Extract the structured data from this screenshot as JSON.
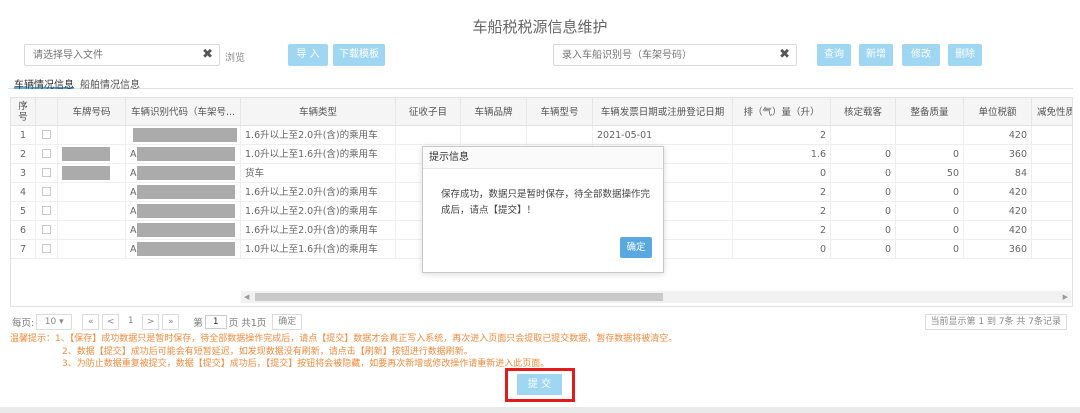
{
  "page": {
    "title": "车船税税源信息维护"
  },
  "toolbar": {
    "file_placeholder": "请选择导入文件",
    "browse_label": "浏览",
    "import_label": "导 入",
    "download_label": "下载模板",
    "vehicle_search_placeholder": "录入车船识别号（车架号码）",
    "query_label": "查询",
    "add_label": "新增",
    "edit_label": "修改",
    "delete_label": "删除"
  },
  "tabs": [
    "车辆情况信息",
    "船舶情况信息"
  ],
  "table": {
    "headers": [
      "序号",
      "",
      "车牌号码",
      "车辆识别代码（车架号...",
      "车辆类型",
      "征收子目",
      "车辆品牌",
      "车辆型号",
      "车辆发票日期或注册登记日期",
      "排（气）量（升）",
      "核定载客",
      "整备质量",
      "单位税额",
      "减免性质"
    ],
    "rows": [
      {
        "no": "1",
        "plate": "",
        "vin": "",
        "type": "1.6升以上至2.0升(含)的乘用车",
        "date": "2021-05-01",
        "disp": "2",
        "seats": "",
        "mass": "",
        "tax": "420"
      },
      {
        "no": "2",
        "plate": "",
        "vin": "A",
        "type": "1.0升以上至1.6升(含)的乘用车",
        "date": "",
        "disp": "1.6",
        "seats": "0",
        "mass": "0",
        "tax": "360"
      },
      {
        "no": "3",
        "plate": "",
        "vin": "A",
        "type": "货车",
        "date": "",
        "disp": "0",
        "seats": "0",
        "mass": "50",
        "tax": "84"
      },
      {
        "no": "4",
        "plate": "",
        "vin": "A",
        "type": "1.6升以上至2.0升(含)的乘用车",
        "date": "",
        "disp": "2",
        "seats": "0",
        "mass": "0",
        "tax": "420"
      },
      {
        "no": "5",
        "plate": "",
        "vin": "A",
        "type": "1.6升以上至2.0升(含)的乘用车",
        "date": "",
        "disp": "2",
        "seats": "0",
        "mass": "0",
        "tax": "420"
      },
      {
        "no": "6",
        "plate": "",
        "vin": "A",
        "type": "1.6升以上至2.0升(含)的乘用车",
        "date": "",
        "disp": "2",
        "seats": "0",
        "mass": "0",
        "tax": "420"
      },
      {
        "no": "7",
        "plate": "",
        "vin": "A",
        "type": "1.0升以上至1.6升(含)的乘用车",
        "date": "",
        "disp": "0",
        "seats": "0",
        "mass": "0",
        "tax": "360"
      }
    ]
  },
  "pager": {
    "per_page_label": "每页:",
    "per_page_value": "10",
    "first": "«",
    "prev": "<",
    "current": "1",
    "next": ">",
    "last": "»",
    "goto_prefix": "第",
    "goto_value": "1",
    "goto_suffix": "页 共1页",
    "confirm_label": "确定",
    "summary": "当前显示第 1 到 7条 共 7条记录"
  },
  "tips": [
    "温馨提示：1、【保存】成功数据只是暂时保存，待全部数据操作完成后，请点【提交】数据才会真正写入系统，再次进入页面只会提取已提交数据，暂存数据将被清空。",
    "2、数据【提交】成功后可能会有短暂延迟，如发现数据没有刷新，请点击【刷新】按钮进行数据刷新。",
    "3、为防止数据重复被提交，数据【提交】成功后，【提交】按钮将会被隐藏，如要再次新增或修改操作请重新进入此页面。"
  ],
  "submit_label": "提 交",
  "dialog": {
    "title": "提示信息",
    "message": "保存成功，数据只是暂时保存，待全部数据操作完成后，请点【提交】！",
    "ok_label": "确定"
  },
  "colors": {
    "button": "#9fd6f2",
    "primary": "#5aa8e0",
    "tip": "#f08a3c",
    "highlight": "#e21c1c"
  }
}
